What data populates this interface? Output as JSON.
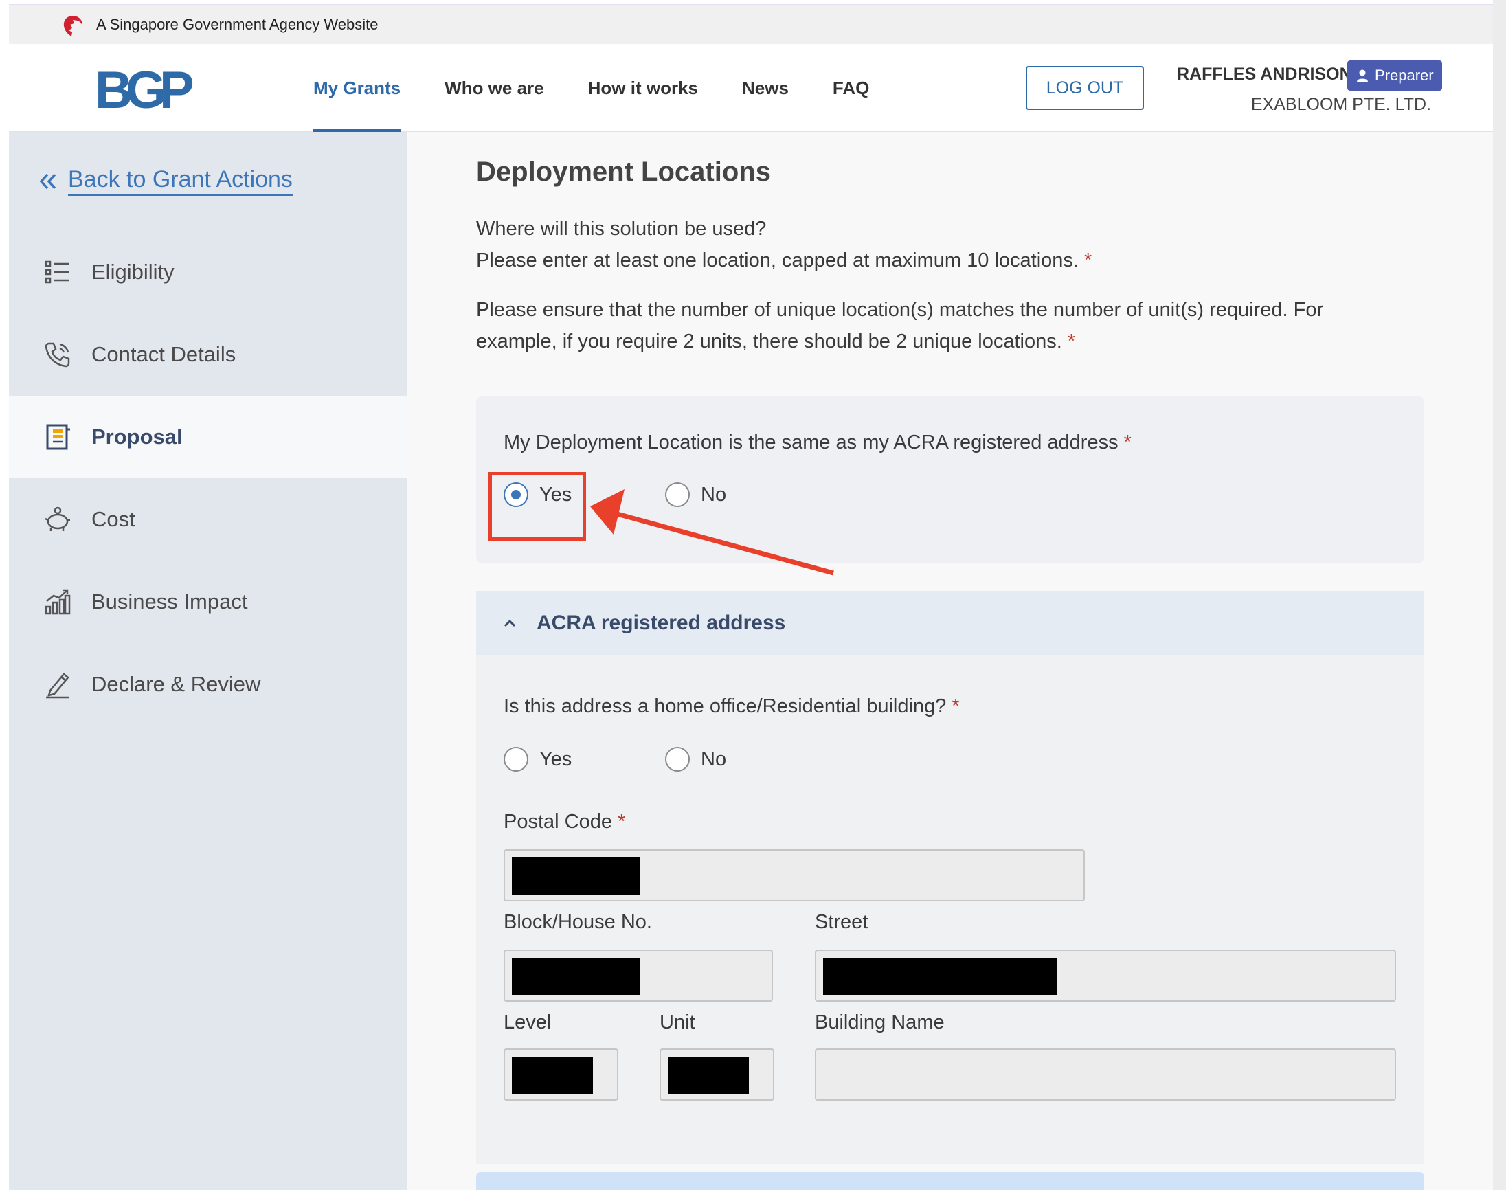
{
  "masthead": {
    "text": "A Singapore Government Agency Website"
  },
  "header": {
    "logo": "BGP",
    "nav": [
      "My Grants",
      "Who we are",
      "How it works",
      "News",
      "FAQ"
    ],
    "logout_label": "LOG OUT",
    "user_name": "RAFFLES ANDRISON",
    "role_badge": "Preparer",
    "company": "EXABLOOM PTE. LTD."
  },
  "sidebar": {
    "back_label": "Back to Grant Actions",
    "items": [
      {
        "label": "Eligibility",
        "icon": "list-icon"
      },
      {
        "label": "Contact Details",
        "icon": "phone-icon"
      },
      {
        "label": "Proposal",
        "icon": "document-icon",
        "active": true
      },
      {
        "label": "Cost",
        "icon": "piggy-bank-icon"
      },
      {
        "label": "Business Impact",
        "icon": "chart-icon"
      },
      {
        "label": "Declare & Review",
        "icon": "pen-icon"
      }
    ]
  },
  "main": {
    "title": "Deployment Locations",
    "para1_line1": "Where will this solution be used?",
    "para1_line2": "Please enter at least one location, capped at maximum 10 locations.",
    "para2": "Please ensure that the number of unique location(s) matches the number of unit(s) required. For example, if you require 2 units, there should be 2 unique locations.",
    "required_mark": "*",
    "acra_question": "My Deployment Location is the same as my ACRA registered address",
    "acra_yes": "Yes",
    "acra_no": "No",
    "acra_selected": "Yes",
    "accordion_title": "ACRA registered address",
    "home_office_question": "Is this address a home office/Residential building?",
    "home_yes": "Yes",
    "home_no": "No",
    "postal_code_label": "Postal Code",
    "block_label": "Block/House No.",
    "street_label": "Street",
    "level_label": "Level",
    "unit_label": "Unit",
    "building_label": "Building Name"
  },
  "colors": {
    "brand": "#2f6aa8",
    "annotation": "#e8402a",
    "badge": "#4a5bb0"
  }
}
